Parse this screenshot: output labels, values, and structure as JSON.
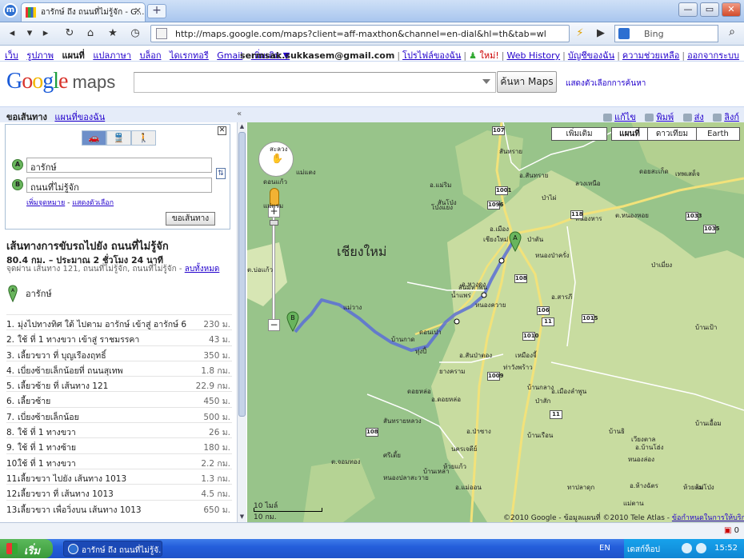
{
  "browser": {
    "app_icon": "browser-logo-icon",
    "tab_title": "อารักษ์ ถึง ถนนที่ไม่รู้จัก - G...",
    "tab_close": "✕",
    "new_tab": "+",
    "window_buttons": [
      "—",
      "▭",
      "✕"
    ],
    "url": "http://maps.google.com/maps?client=aff-maxthon&channel=en-dial&hl=th&tab=wl",
    "search_engine": "Bing"
  },
  "gbar": {
    "links": [
      "เว็บ",
      "รูปภาพ"
    ],
    "current": "แผนที่",
    "links2": [
      "แปลภาษา",
      "บล็อก",
      "ไดเรกทอรี",
      "Gmail",
      "เพิ่มเติม ▼"
    ],
    "email": "sermsak.sukkasem@gmail.com",
    "profile": "โปรไฟล์ของฉัน",
    "new_label": "ใหม่!",
    "web_history": "Web History",
    "account": "บัญชีของฉัน",
    "help": "ความช่วยเหลือ",
    "signout": "ออกจากระบบ"
  },
  "header": {
    "logo": "Google",
    "logo_product": "maps",
    "search_value": "",
    "search_button": "ค้นหา Maps",
    "options_link": "แสดงตัวเลือกการค้นหา"
  },
  "bar2": {
    "directions_tab": "ขอเส้นทาง",
    "mymaps_tab": "แผนที่ของฉัน",
    "collapse": "«",
    "edit": "แก้ไข",
    "print": "พิมพ์",
    "send": "ส่ง",
    "link": "ลิงก์"
  },
  "directions": {
    "modes": [
      "🚗",
      "🚆",
      "🚶"
    ],
    "from_label": "A",
    "from_value": "อารักษ์",
    "to_label": "B",
    "to_value": "ถนนที่ไม่รู้จัก",
    "add_destination": "เพิ่มจุดหมาย",
    "show_options": "แสดงตัวเลือก",
    "get_button": "ขอเส้นทาง"
  },
  "route": {
    "title": "เส้นทางการขับรถไปยัง ถนนที่ไม่รู้จัก",
    "summary": "80.4 กม. – ประมาณ 2 ชั่วโมง 24 นาที",
    "via": "จุดผ่าน เส้นทาง 121, ถนนที่ไม่รู้จัก, ถนนที่ไม่รู้จัก",
    "remove_all": "ลบทั้งหมด",
    "start_name": "อารักษ์",
    "steps": [
      {
        "n": "1.",
        "text": "มุ่งไปทางทิศ ใต้ ไปตาม อารักษ์ เข้าสู่ อารักษ์ 6",
        "dist": "230 ม."
      },
      {
        "n": "2.",
        "text": "ใช้ ที่ 1 ทางขวา เข้าสู่ ราชมรรคา",
        "dist": "43 ม."
      },
      {
        "n": "3.",
        "text": "เลี้ยวขวา ที่ บุญเรืองฤทธิ์",
        "dist": "350 ม."
      },
      {
        "n": "4.",
        "text": "เบี่ยงซ้ายเล็กน้อยที่ ถนนสุเทพ",
        "dist": "1.8 กม."
      },
      {
        "n": "5.",
        "text": "เลี้ยวซ้าย ที่ เส้นทาง 121",
        "dist": "22.9 กม."
      },
      {
        "n": "6.",
        "text": "เลี้ยวซ้าย",
        "dist": "450 ม."
      },
      {
        "n": "7.",
        "text": "เบี่ยงซ้ายเล็กน้อย",
        "dist": "500 ม."
      },
      {
        "n": "8.",
        "text": "ใช้ ที่ 1 ทางขวา",
        "dist": "26 ม."
      },
      {
        "n": "9.",
        "text": "ใช้ ที่ 1 ทางซ้าย",
        "dist": "180 ม."
      },
      {
        "n": "10.",
        "text": "ใช้ ที่ 1 ทางขวา",
        "dist": "2.2 กม."
      },
      {
        "n": "11.",
        "text": "เลี้ยวขวา ไปยัง เส้นทาง 1013",
        "dist": "1.3 กม."
      },
      {
        "n": "12.",
        "text": "เลี้ยวขวา ที่ เส้นทาง 1013",
        "dist": "4.5 กม."
      },
      {
        "n": "13.",
        "text": "เลี้ยวขวา เพื่อวิ่งบน เส้นทาง 1013",
        "dist": "650 ม."
      }
    ]
  },
  "map": {
    "types": [
      "เพิ่มเติม",
      "แผนที่",
      "ดาวเทียม",
      "Earth"
    ],
    "active_type": "แผนที่",
    "province": "เชียงใหม่",
    "scale_mi": "10 ไมล์",
    "scale_km": "10 กม.",
    "copyright": "©2010 Google - ข้อมูลแผนที่ ©2010 Tele Atlas -",
    "terms": "ข้อกำหนดในการให้บริการ",
    "zoom_in": "+",
    "zoom_out": "−",
    "route_color": "#5b6fd6",
    "labels": [
      "สะลวง",
      "แม่แตง",
      "อ.แม่ริม",
      "สันทราย",
      "อ.สันทราย",
      "ลวงเหนือ",
      "ป่าไผ่",
      "หนองหาร",
      "สันโป่ง",
      "ดอนแก้ว",
      "โป่งแยง",
      "แม่แรม",
      "อ.เมือง",
      "เชียงใหม่",
      "ป่าตัน",
      "หนองป่าครั่ง",
      "ต.บ่อแก้ว",
      "แม่วาง",
      "บ้านกาด",
      "ดอนเปา",
      "อ.หางดง",
      "น้ำแพร่",
      "หนองควาย",
      "อ.สารภี",
      "ต.หนองหอย",
      "ดอยหล่อ",
      "อ.ดอยหล่อ",
      "อ.สันป่าตอง",
      "ยางคราม",
      "ท่าวังพร้าว",
      "เหมืองจี้",
      "อ.เมืองลำพูน",
      "บ้านกลาง",
      "ป่าสัก",
      "สันทรายหลวง",
      "ต.จอมทอง",
      "อ.ป่าซาง",
      "นครเจดีย์",
      "บ้านเรือน",
      "อ.บ้านโฮ่ง",
      "ศรีเตี้ย",
      "หนองปลาสะวาย",
      "อ.แม่ออน",
      "ห้วยแก้ว",
      "บ้านเหล่า",
      "ทาปลาดุก",
      "บ้านธิ",
      "เวียงตาล",
      "หนองล่อง",
      "อ.ห้างฉัตร",
      "ห้วยส้ม",
      "แม่ตาน",
      "ทุ่งปี้",
      "สันมหาพน",
      "ดอยสะเก็ด",
      "เทพเสด็จ",
      "ป่าเมี่ยง",
      "แม่โป่ง",
      "บ้านเอื้อม",
      "บ้านเป้า"
    ],
    "shields": [
      "107",
      "1001",
      "1096",
      "118",
      "108",
      "106",
      "11",
      "1010",
      "1015",
      "1009",
      "108",
      "11",
      "1033",
      "1035"
    ],
    "pins": [
      "A",
      "B"
    ]
  },
  "status": {
    "right": "0"
  },
  "taskbar": {
    "start": "เริ่ม",
    "task": "อารักษ์ ถึง ถนนที่ไม่รู้จั...",
    "lang": "EN",
    "desktop": "เดสก์ท็อป",
    "time": "15:52"
  }
}
